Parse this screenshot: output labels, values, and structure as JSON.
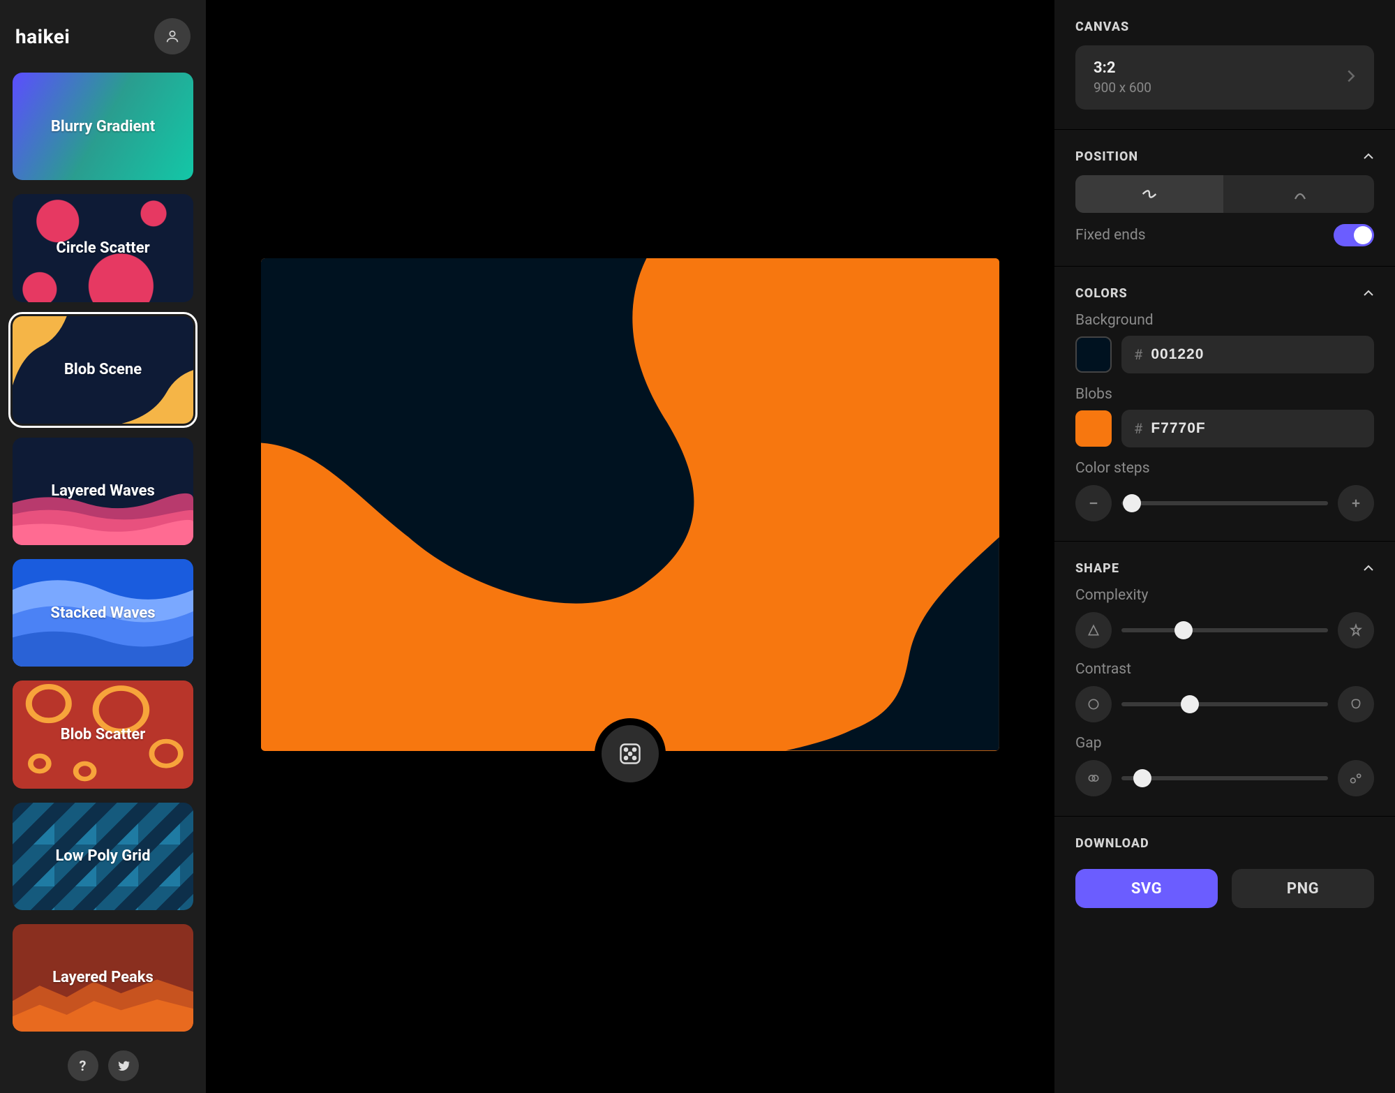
{
  "app": {
    "logo": "haikei"
  },
  "sidebar": {
    "generators": [
      {
        "label": "Blurry Gradient",
        "selected": false
      },
      {
        "label": "Circle Scatter",
        "selected": false
      },
      {
        "label": "Blob Scene",
        "selected": true
      },
      {
        "label": "Layered Waves",
        "selected": false
      },
      {
        "label": "Stacked Waves",
        "selected": false
      },
      {
        "label": "Blob Scatter",
        "selected": false
      },
      {
        "label": "Low Poly Grid",
        "selected": false
      },
      {
        "label": "Layered Peaks",
        "selected": false
      }
    ]
  },
  "panel": {
    "canvas": {
      "title": "CANVAS",
      "ratio": "3:2",
      "dims": "900 x 600"
    },
    "position": {
      "title": "POSITION",
      "fixed_ends_label": "Fixed ends",
      "fixed_ends": true
    },
    "colors": {
      "title": "COLORS",
      "bg_label": "Background",
      "bg_hex": "001220",
      "blobs_label": "Blobs",
      "blobs_hex": "F7770F",
      "steps_label": "Color steps",
      "steps_value": 0.05
    },
    "shape": {
      "title": "SHAPE",
      "complexity_label": "Complexity",
      "complexity_value": 0.3,
      "contrast_label": "Contrast",
      "contrast_value": 0.33,
      "gap_label": "Gap",
      "gap_value": 0.1
    },
    "download": {
      "title": "DOWNLOAD",
      "svg_label": "SVG",
      "png_label": "PNG"
    }
  }
}
